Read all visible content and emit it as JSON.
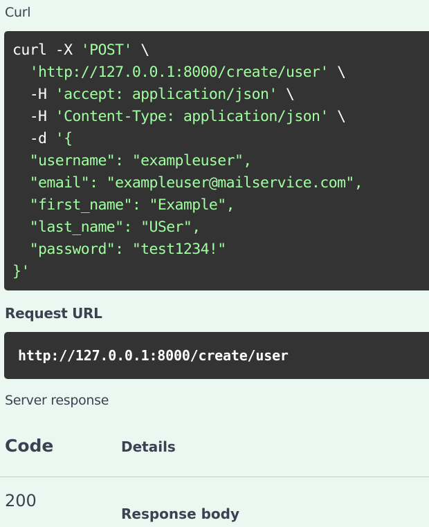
{
  "curl": {
    "label": "Curl",
    "lines": [
      [
        {
          "t": "curl -X ",
          "c": "plain"
        },
        {
          "t": "'POST'",
          "c": "str"
        },
        {
          "t": " \\",
          "c": "plain"
        }
      ],
      [
        {
          "t": "  ",
          "c": "plain"
        },
        {
          "t": "'http://127.0.0.1:8000/create/user'",
          "c": "str"
        },
        {
          "t": " \\",
          "c": "plain"
        }
      ],
      [
        {
          "t": "  -H ",
          "c": "plain"
        },
        {
          "t": "'accept: application/json'",
          "c": "str"
        },
        {
          "t": " \\",
          "c": "plain"
        }
      ],
      [
        {
          "t": "  -H ",
          "c": "plain"
        },
        {
          "t": "'Content-Type: application/json'",
          "c": "str"
        },
        {
          "t": " \\",
          "c": "plain"
        }
      ],
      [
        {
          "t": "  -d ",
          "c": "plain"
        },
        {
          "t": "'{",
          "c": "str"
        }
      ],
      [
        {
          "t": "  \"username\": \"exampleuser\",",
          "c": "str"
        }
      ],
      [
        {
          "t": "  \"email\": \"exampleuser@mailservice.com\",",
          "c": "str"
        }
      ],
      [
        {
          "t": "  \"first_name\": \"Example\",",
          "c": "str"
        }
      ],
      [
        {
          "t": "  \"last_name\": \"USer\",",
          "c": "str"
        }
      ],
      [
        {
          "t": "  \"password\": \"test1234!\"",
          "c": "str"
        }
      ],
      [
        {
          "t": "}'",
          "c": "str"
        }
      ]
    ]
  },
  "request_url": {
    "label": "Request URL",
    "value": "http://127.0.0.1:8000/create/user"
  },
  "server_response": {
    "label": "Server response",
    "code_header": "Code",
    "details_header": "Details",
    "code": "200",
    "response_body_label": "Response body"
  },
  "colors": {
    "background": "#ebf8f2",
    "code_bg": "#333333",
    "string": "#a2fca2",
    "text": "#3b4151"
  }
}
